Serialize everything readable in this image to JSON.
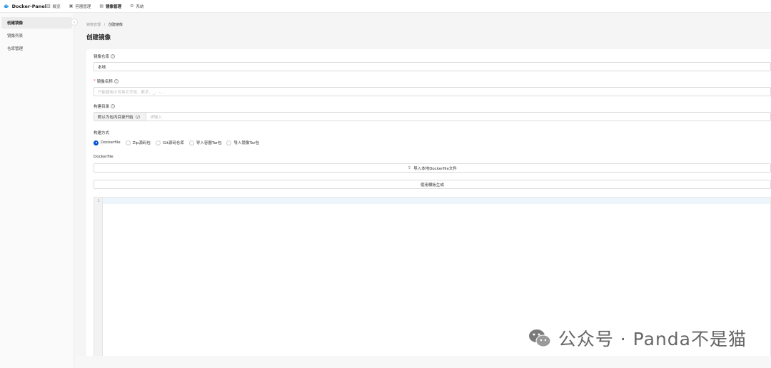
{
  "app": {
    "brand": "Docker-Panel"
  },
  "nav": [
    {
      "label": "概览",
      "icon": "chart-icon",
      "glyph": "▥"
    },
    {
      "label": "容器管理",
      "icon": "container-icon",
      "glyph": "▣"
    },
    {
      "label": "镜像管理",
      "icon": "image-icon",
      "glyph": "▤",
      "active": true
    },
    {
      "label": "系统",
      "icon": "gear-icon",
      "glyph": "⚙"
    }
  ],
  "sidebar": {
    "items": [
      {
        "label": "创建镜像",
        "active": true
      },
      {
        "label": "镜像列表"
      },
      {
        "label": "仓库管理"
      }
    ],
    "collapse_glyph": "‹"
  },
  "breadcrumb": {
    "parent": "镜像管理",
    "separator": "/",
    "current": "创建镜像"
  },
  "page_title": "创建镜像",
  "form": {
    "repo": {
      "label": "镜像仓库",
      "value": "本地"
    },
    "name": {
      "label": "镜像名称",
      "required_mark": "*",
      "placeholder": "只能使用小写英文字母、数字、_、-、."
    },
    "build_dir": {
      "label": "构建目录",
      "addon": "默认为包内目录开始（/）",
      "placeholder": "请输入"
    },
    "build_method": {
      "label": "构建方式",
      "options": [
        "Dockerfile",
        "Zip源码包",
        "Git源码仓库",
        "导入容器Tar包",
        "导入镜像Tar包"
      ],
      "selected": "Dockerfile"
    },
    "dockerfile": {
      "label": "Dockerfile",
      "import_button": "导入本地Dockerfile文件",
      "template_button": "使用模板生成",
      "line_number": "1"
    }
  },
  "watermark": {
    "text": "公众号 · Panda不是猫",
    "icon": "wechat-icon"
  },
  "colors": {
    "primary": "#0052d9",
    "sidebar_active": "#ececec",
    "required": "#e34d59"
  }
}
